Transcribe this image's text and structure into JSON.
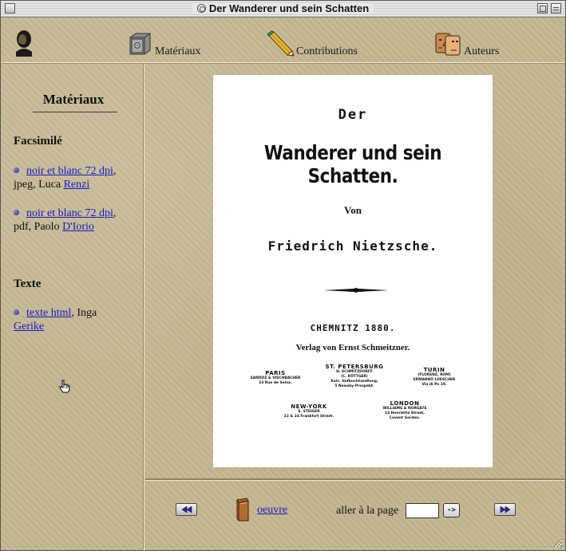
{
  "window": {
    "title": "Der Wanderer und sein Schatten"
  },
  "toolbar": {
    "items": [
      {
        "label": "Matériaux",
        "icon": "safe-icon"
      },
      {
        "label": "Contributions",
        "icon": "pencil-icon"
      },
      {
        "label": "Auteurs",
        "icon": "faces-icon"
      }
    ]
  },
  "sidebar": {
    "heading": "Matériaux",
    "sections": [
      {
        "title": "Facsimilé",
        "entries": [
          {
            "link": "noir et blanc 72 dpi",
            "sep": ",",
            "text": "jpeg, Luca",
            "author_link": "Renzi"
          },
          {
            "link": "noir et blanc 72 dpi",
            "sep": ",",
            "text": "pdf, Paolo",
            "author_link": "D'Iorio"
          }
        ]
      },
      {
        "title": "Texte",
        "entries": [
          {
            "link": "texte html",
            "sep": ",",
            "text": "Inga",
            "author_link": "Gerike"
          }
        ]
      }
    ]
  },
  "facsimile": {
    "der": "Der",
    "title": "Wanderer und sein Schatten.",
    "von": "Von",
    "author": "Friedrich Nietzsche.",
    "city_year": "CHEMNITZ 1880.",
    "publisher": "Verlag von Ernst Schmeitzner.",
    "imprints": {
      "paris": {
        "city": "PARIS",
        "lines": [
          "SANDOZ & VISCHBACHER",
          "33 Rue de Seine."
        ]
      },
      "stpetersburg": {
        "city": "ST. PETERSBURG",
        "lines": [
          "H. SCHMITZDORFF",
          "(C. RÖTTGER)",
          "Kais. Hofbuchhandlung,",
          "5 Newsky-Prospekt."
        ]
      },
      "turin": {
        "city": "TURIN",
        "lines": [
          "(FLORENZ, ROM)",
          "ERMANNO LOESCHER",
          "Via di Po 19."
        ]
      },
      "newyork": {
        "city": "NEW-YORK",
        "lines": [
          "E. STEIGER",
          "22 & 24 Frankfort Street."
        ]
      },
      "london": {
        "city": "LONDON",
        "lines": [
          "WILLIAMS & NORGATE",
          "14 Henrietta Street,",
          "Covent Garden."
        ]
      }
    }
  },
  "bottom": {
    "oeuvre": "oeuvre",
    "goto_label": "aller à la page",
    "page_value": "",
    "go_label": "->"
  }
}
